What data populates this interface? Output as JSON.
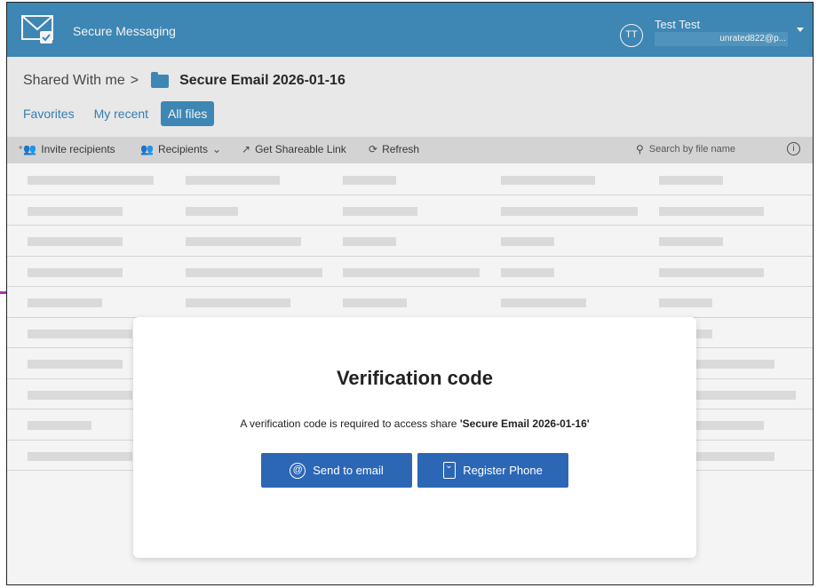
{
  "header": {
    "app_title": "Secure Messaging",
    "avatar_initials": "TT",
    "user_name": "Test Test",
    "user_email": "unrated822@p..."
  },
  "breadcrumb": {
    "parent": "Shared With me",
    "separator": ">",
    "current": "Secure Email 2026-01-16"
  },
  "tabs": [
    {
      "label": "Favorites",
      "active": false
    },
    {
      "label": "My recent",
      "active": false
    },
    {
      "label": "All files",
      "active": true
    }
  ],
  "toolbar": {
    "invite": "Invite recipients",
    "recipients": "Recipients",
    "shareable_link": "Get Shareable Link",
    "refresh": "Refresh",
    "search_placeholder": "Search by file name"
  },
  "modal": {
    "title": "Verification code",
    "message_prefix": "A verification code is required to access share ",
    "message_share": "'Secure Email 2026-01-16'",
    "send_email": "Send to email",
    "register_phone": "Register Phone"
  },
  "colors": {
    "header": "#3a88b9",
    "button": "#2c67b6",
    "tab_active": "#3a88b9"
  }
}
